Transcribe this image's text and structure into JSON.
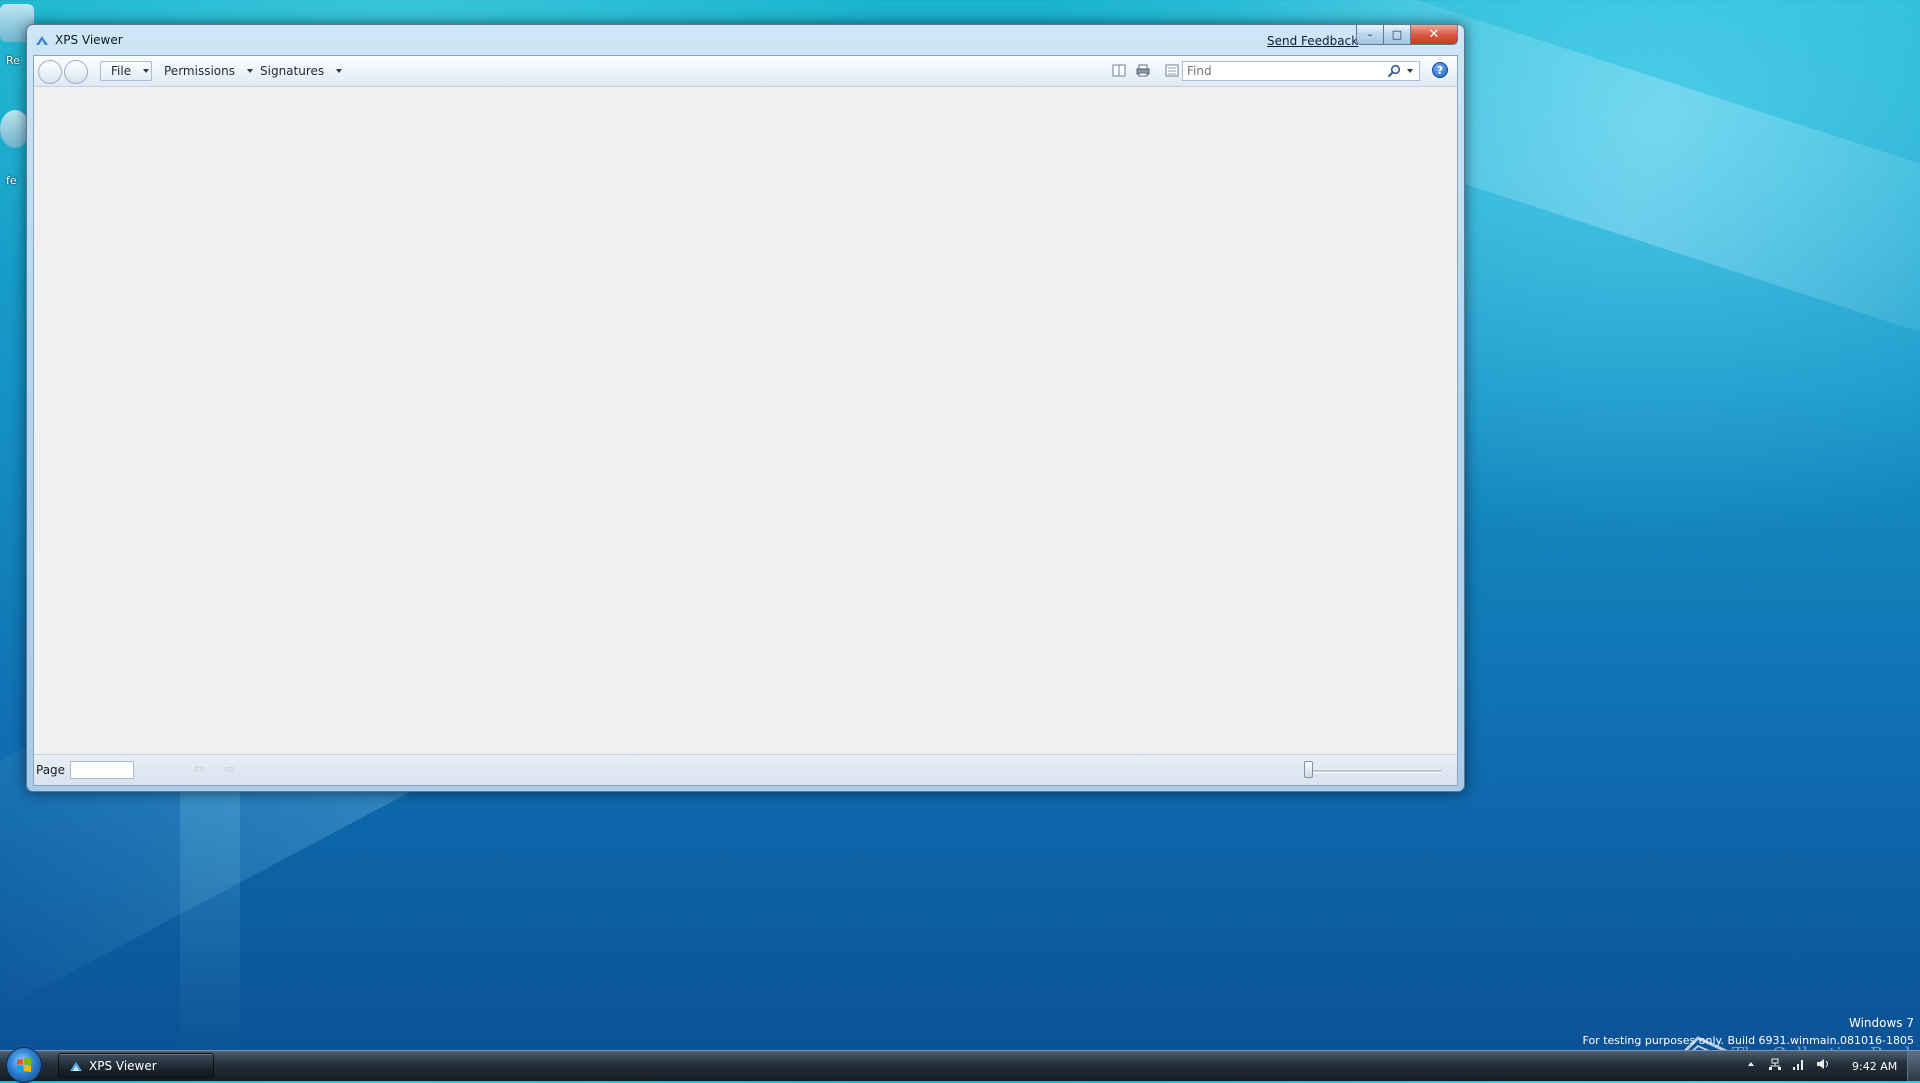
{
  "window": {
    "title": "XPS Viewer",
    "send_feedback": "Send Feedback",
    "caption": {
      "minimize": "–",
      "maximize": "□",
      "close": "✕"
    }
  },
  "toolbar": {
    "menus": {
      "file": "File",
      "permissions": "Permissions",
      "signatures": "Signatures"
    },
    "find_placeholder": "Find",
    "help": "?"
  },
  "statusbar": {
    "page_label": "Page",
    "page_value": "",
    "prev": "⇦",
    "next": "⇨",
    "zoom_level": 0.0
  },
  "desktop": {
    "icon_label_1": "Re",
    "icon_label_2": "fe",
    "watermark_line1": "Windows 7",
    "watermark_line2": "For testing purposes only. Build 6931.winmain.081016-1805",
    "watermark_site": "The Collection Book"
  },
  "taskbar": {
    "active_app": "XPS Viewer",
    "clock": "9:42 AM"
  },
  "icons": {
    "app": "xps-viewer-icon",
    "view": "two-page-view-icon",
    "print": "printer-icon",
    "layout": "page-layout-icon",
    "search": "magnifier-icon",
    "help": "help-icon",
    "start": "windows-flag-icon",
    "tray": [
      "show-hidden-icons-icon",
      "network-icon",
      "signal-icon",
      "volume-icon"
    ]
  },
  "colors": {
    "close_button": "#c8381c",
    "help_button": "#1c5cc0",
    "desktop_accent": "#1593c6"
  }
}
